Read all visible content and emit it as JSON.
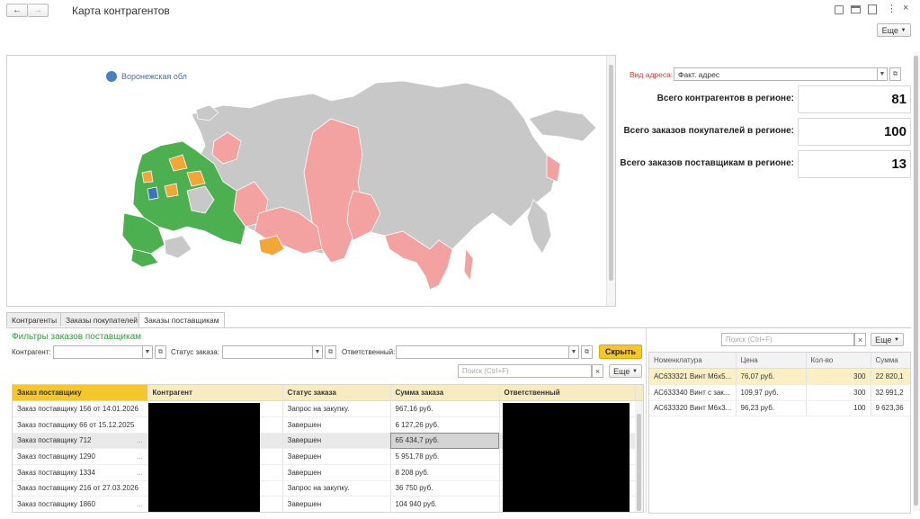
{
  "window": {
    "title": "Карта контрагентов",
    "more_label": "Еще"
  },
  "map": {
    "legend_label": "Воронежская обл",
    "colors": {
      "green": "#4caf50",
      "pink": "#f3a1a1",
      "orange": "#f2a637",
      "gray": "#c8c8c8",
      "blue": "#3f73b8"
    }
  },
  "address": {
    "label": "Вид адреса:",
    "value": "Факт. адрес"
  },
  "stats": [
    {
      "label": "Всего контрагентов в регионе:",
      "value": "81"
    },
    {
      "label": "Всего заказов покупателей в регионе:",
      "value": "100"
    },
    {
      "label": "Всего заказов поставщикам в регионе:",
      "value": "13"
    }
  ],
  "tabs": [
    "Контрагенты",
    "Заказы покупателей",
    "Заказы поставщикам"
  ],
  "filters": {
    "title": "Фильтры заказов поставщикам",
    "contractor_label": "Контрагент:",
    "status_label": "Статус заказа:",
    "responsible_label": "Ответственный:",
    "hide_label": "Скрыть",
    "search_placeholder": "Поиск (Ctrl+F)",
    "more_label": "Еще"
  },
  "orders": {
    "columns": [
      "Заказ поставщику",
      "Контрагент",
      "Статус заказа",
      "Сумма заказа",
      "Ответственный"
    ],
    "rows": [
      {
        "order": "Заказ поставщику 156 от 14.01.2026",
        "status": "Запрос на закупку.",
        "sum": "967,16 руб."
      },
      {
        "order": "Заказ поставщику 66 от 15.12.2025",
        "status": "Завершен",
        "sum": "6 127,26 руб."
      },
      {
        "order": "Заказ поставщику 712",
        "status": "Завершен",
        "sum": "65 434,7 руб."
      },
      {
        "order": "Заказ поставщику 1290",
        "status": "Завершен",
        "sum": "5 951,78 руб."
      },
      {
        "order": "Заказ поставщику 1334",
        "status": "Завершен",
        "sum": "8 208 руб."
      },
      {
        "order": "Заказ поставщику 216 от 27.03.2026",
        "status": "Запрос на закупку.",
        "sum": "36 750 руб."
      },
      {
        "order": "Заказ поставщику 1860",
        "status": "Завершен",
        "sum": "104 940 руб."
      }
    ],
    "ellipsis": "..."
  },
  "items": {
    "search_placeholder": "Поиск (Ctrl+F)",
    "more_label": "Еще",
    "columns": [
      "Номенклатура",
      "Цена",
      "Кол-во",
      "Сумма"
    ],
    "rows": [
      {
        "name": "АС633321 Винт М6х5...",
        "price": "76,07 руб.",
        "qty": "300",
        "sum": "22 820,1"
      },
      {
        "name": "АС633340 Винт с зак...",
        "price": "109,97 руб.",
        "qty": "300",
        "sum": "32 991,2"
      },
      {
        "name": "АС633320 Винт М6х3...",
        "price": "96,23 руб.",
        "qty": "100",
        "sum": "9 623,36"
      }
    ]
  }
}
